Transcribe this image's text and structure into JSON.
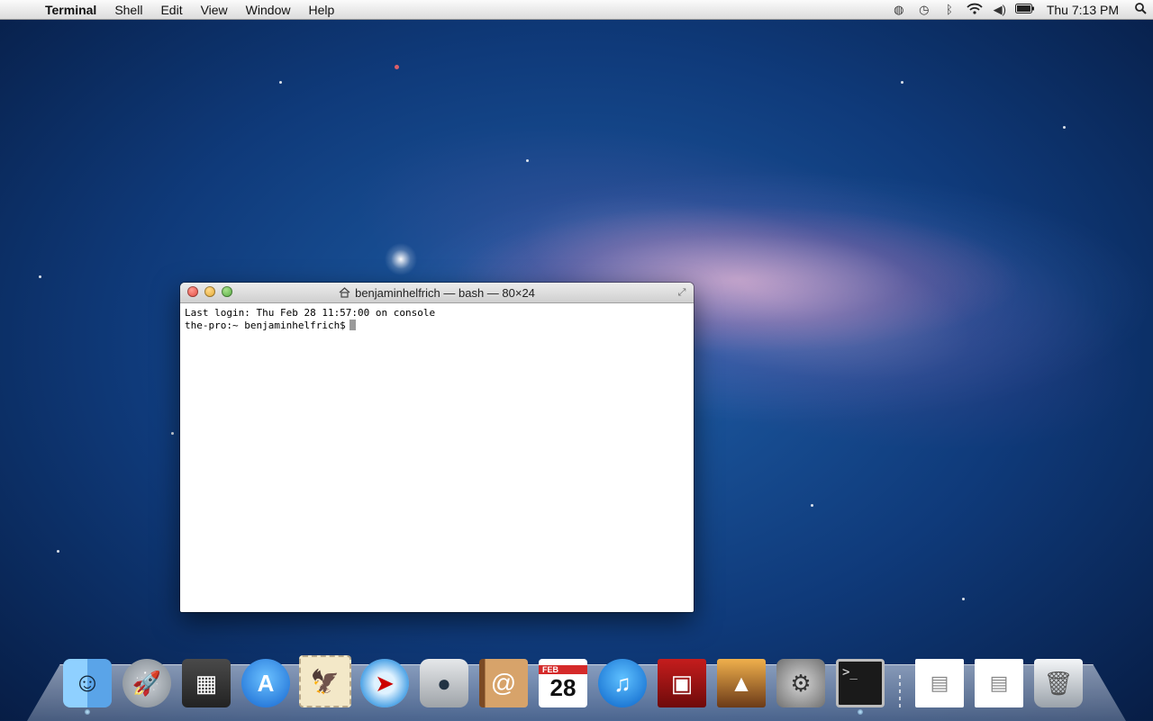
{
  "menubar": {
    "apple": "",
    "app_name": "Terminal",
    "menus": [
      "Shell",
      "Edit",
      "View",
      "Window",
      "Help"
    ],
    "status_icons": [
      "time-machine-icon",
      "history-icon",
      "bluetooth-icon",
      "wifi-icon",
      "volume-icon",
      "battery-icon"
    ],
    "clock": "Thu 7:13 PM",
    "spotlight": "spotlight-icon"
  },
  "window": {
    "title": "benjaminhelfrich — bash — 80×24",
    "lines": [
      "Last login: Thu Feb 28 11:57:00 on console",
      "the-pro:~ benjaminhelfrich$"
    ]
  },
  "dock": {
    "items": [
      {
        "name": "finder",
        "glyph": "☺",
        "running": true
      },
      {
        "name": "launchpad",
        "glyph": "🚀",
        "running": false
      },
      {
        "name": "mission-control",
        "glyph": "▦",
        "running": false
      },
      {
        "name": "app-store",
        "glyph": "A",
        "running": false
      },
      {
        "name": "mail",
        "glyph": "🦅",
        "running": false
      },
      {
        "name": "safari",
        "glyph": "➤",
        "running": false
      },
      {
        "name": "facetime",
        "glyph": "●",
        "running": false
      },
      {
        "name": "address-book",
        "glyph": "@",
        "running": false
      },
      {
        "name": "calendar",
        "glyph": "28",
        "month": "FEB",
        "running": false
      },
      {
        "name": "itunes",
        "glyph": "♫",
        "running": false
      },
      {
        "name": "photo-booth",
        "glyph": "▣",
        "running": false
      },
      {
        "name": "iphoto",
        "glyph": "▲",
        "running": false
      },
      {
        "name": "system-preferences",
        "glyph": "⚙",
        "running": false
      },
      {
        "name": "terminal",
        "glyph": ">_",
        "running": true
      }
    ],
    "stacks": [
      {
        "name": "documents",
        "glyph": "▤"
      },
      {
        "name": "downloads",
        "glyph": "▤"
      },
      {
        "name": "trash",
        "glyph": "🗑"
      }
    ]
  }
}
